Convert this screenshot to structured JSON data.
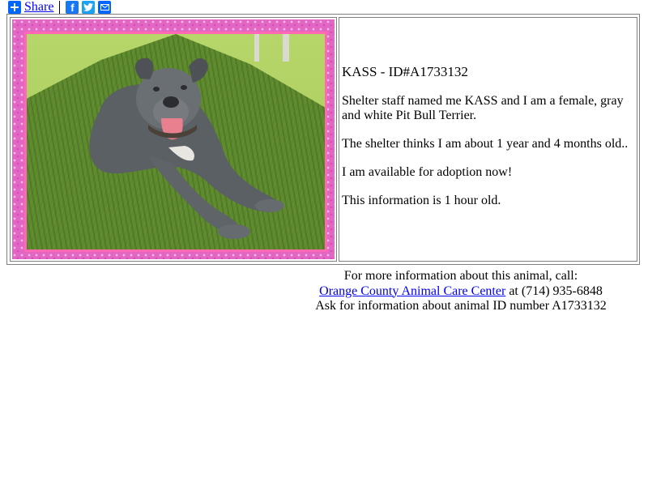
{
  "share": {
    "label": "Share",
    "icons": [
      "share-plus-icon",
      "facebook-icon",
      "twitter-icon",
      "email-icon"
    ]
  },
  "animal": {
    "heading": "KASS - ID#A1733132",
    "description": "Shelter staff named me KASS and I am a female, gray and white Pit Bull Terrier.",
    "age": "The shelter thinks I am about 1 year and 4 months old..",
    "availability": "I am available for adoption now!",
    "freshness": "This information is 1 hour old."
  },
  "contact": {
    "intro": "For more information about this animal, call:",
    "center_name": "Orange County Animal Care Center",
    "phone_text": " at (714) 935-6848",
    "ask_text": "Ask for information about animal ID number A1733132"
  },
  "colors": {
    "frame_pink": "#e466c4",
    "link_blue": "#0000ee",
    "share_blue": "#0166ff"
  }
}
